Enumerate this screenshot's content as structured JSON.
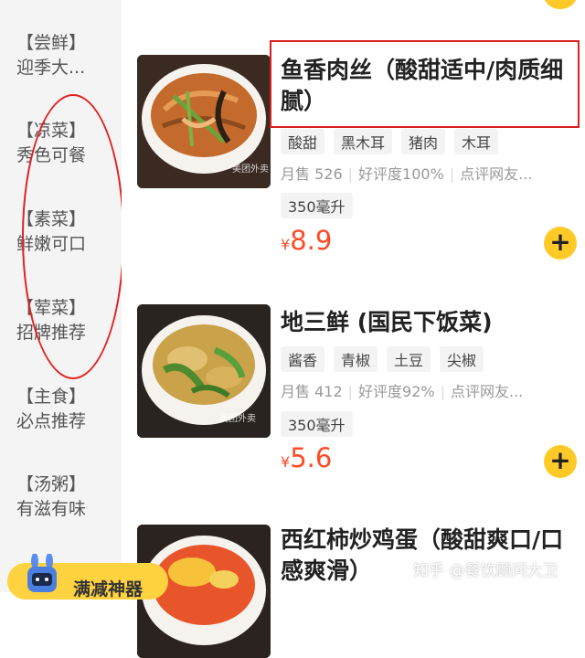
{
  "sidebar": {
    "categories": [
      {
        "name": "【尝鲜】",
        "desc": "迎季大..."
      },
      {
        "name": "【凉菜】",
        "desc": "秀色可餐"
      },
      {
        "name": "【素菜】",
        "desc": "鲜嫩可口"
      },
      {
        "name": "【荤菜】",
        "desc": "招牌推荐"
      },
      {
        "name": "【主食】",
        "desc": "必点推荐"
      },
      {
        "name": "【汤粥】",
        "desc": "有滋有味"
      }
    ],
    "promo_label": "满减神器"
  },
  "dishes": [
    {
      "title": "鱼香肉丝（酸甜适中/肉质细腻）",
      "tags": [
        "酸甜",
        "黑木耳",
        "猪肉",
        "木耳"
      ],
      "sales": "月售 526",
      "rating": "好评度100%",
      "review": "点评网友...",
      "volume": "350毫升",
      "price_symbol": "¥",
      "price": "8.9",
      "img_caption": "美团外卖"
    },
    {
      "title": "地三鲜 (国民下饭菜)",
      "tags": [
        "酱香",
        "青椒",
        "土豆",
        "尖椒"
      ],
      "sales": "月售 412",
      "rating": "好评度92%",
      "review": "点评网友...",
      "volume": "350毫升",
      "price_symbol": "¥",
      "price": "5.6",
      "img_caption": "美团外卖"
    },
    {
      "title": "西红柿炒鸡蛋（酸甜爽口/口感爽滑）"
    }
  ],
  "add_label": "+",
  "watermark": "知乎 @餐饮顾问大卫",
  "colors": {
    "accent": "#ffc928",
    "price": "#ff4a26",
    "annotation": "#d81e1e"
  }
}
